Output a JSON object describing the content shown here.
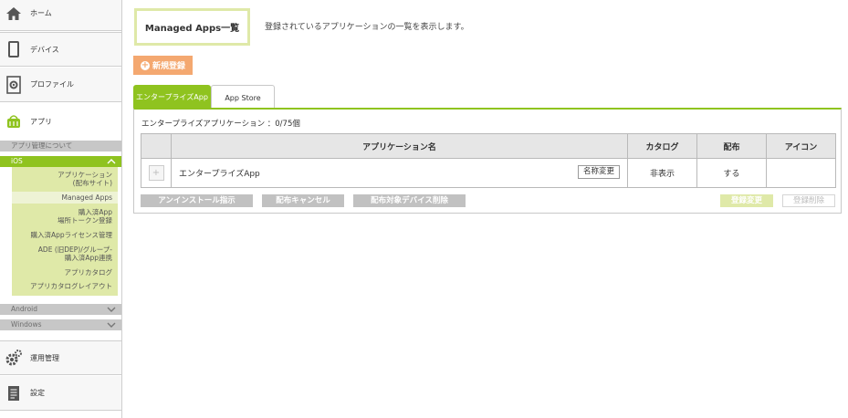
{
  "sidebar": {
    "home_label": "ホーム",
    "device_label": "デバイス",
    "profile_label": "プロファイル",
    "app_label": "アプリ",
    "about_label": "アプリ管理について",
    "ios_label": "iOS",
    "ios_items": [
      {
        "label": "アプリケーション\n(配布サイト)"
      },
      {
        "label": "Managed Apps"
      },
      {
        "label": "購入済App\n場所トークン登録"
      },
      {
        "label": "購入済Appライセンス管理"
      },
      {
        "label": "ADE (旧DEP)/グループ-\n購入済App連携"
      },
      {
        "label": "アプリカタログ"
      },
      {
        "label": "アプリカタログレイアウト"
      }
    ],
    "android_label": "Android",
    "windows_label": "Windows",
    "ops_label": "運用管理",
    "settings_label": "設定"
  },
  "header": {
    "title": "Managed Apps一覧",
    "description": "登録されているアプリケーションの一覧を表示します。"
  },
  "new_button_label": "新規登録",
  "tabs": [
    {
      "label": "エンタープライズApp",
      "active": true
    },
    {
      "label": "App Store",
      "active": false
    }
  ],
  "panel": {
    "caption": "エンタープライズアプリケーション ：0/75個",
    "columns": [
      "",
      "アプリケーション名",
      "カタログ",
      "配布",
      "アイコン"
    ],
    "rows": [
      {
        "name": "エンタープライズApp",
        "rename_label": "名称変更",
        "catalog": "非表示",
        "distribution": "する",
        "icon": ""
      }
    ],
    "actions": {
      "uninstall": "アンインストール指示",
      "cancel_distribution": "配布キャンセル",
      "delete_target_devices": "配布対象デバイス削除",
      "save_changes": "登録変更",
      "delete_registration": "登録削除"
    }
  },
  "colors": {
    "accent_green": "#8fc31f",
    "light_green": "#dfe9a8",
    "orange": "#f4a870",
    "gray_button": "#c1c1c1"
  }
}
